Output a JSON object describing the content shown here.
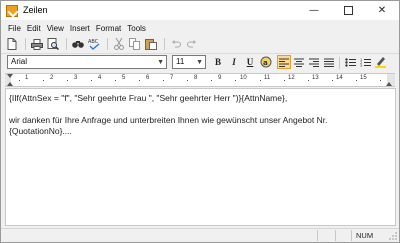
{
  "window": {
    "title": "Zeilen",
    "minimize_symbol": "—",
    "close_symbol": "✕"
  },
  "menu": [
    {
      "label": "File"
    },
    {
      "label": "Edit"
    },
    {
      "label": "View"
    },
    {
      "label": "Insert"
    },
    {
      "label": "Format"
    },
    {
      "label": "Tools"
    }
  ],
  "toolbar": {
    "icons": [
      "new-document-icon",
      "print-icon",
      "print-preview-icon",
      "find-icon",
      "spellcheck-icon",
      "cut-icon",
      "copy-icon",
      "paste-icon",
      "undo-icon",
      "redo-icon"
    ]
  },
  "format": {
    "font_name": "Arial",
    "font_size": "11",
    "bold_label": "B",
    "italic_label": "I",
    "underline_label": "U",
    "active_alignment": "left"
  },
  "ruler": {
    "numbers": [
      "1",
      "2",
      "3",
      "4",
      "5",
      "6",
      "7",
      "8",
      "9",
      "10",
      "11",
      "12",
      "13",
      "14",
      "15"
    ]
  },
  "editor": {
    "line1": "{IIf(AttnSex = \"f\", \"Sehr geehrte Frau \", \"Sehr geehrter Herr \")}{AttnName},",
    "line2": "",
    "line3": "wir danken für Ihre Anfrage und unterbreiten Ihnen wie gewünscht unser Angebot Nr.",
    "line4": "{QuotationNo}...."
  },
  "status": {
    "num_indicator": "NUM"
  },
  "colors": {
    "accent": "#f0a020",
    "active_button": "#ffd990"
  }
}
